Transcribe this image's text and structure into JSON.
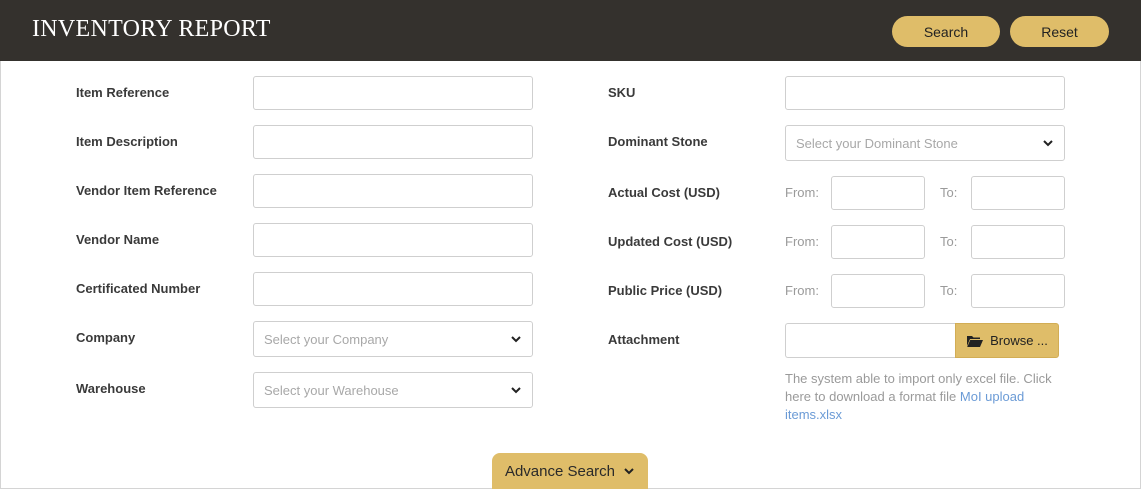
{
  "header": {
    "title": "INVENTORY REPORT",
    "search_label": "Search",
    "reset_label": "Reset"
  },
  "left": {
    "item_reference": "Item Reference",
    "item_description": "Item Description",
    "vendor_item_reference": "Vendor Item Reference",
    "vendor_name": "Vendor Name",
    "certificated_number": "Certificated Number",
    "company": "Company",
    "company_placeholder": "Select your Company",
    "warehouse": "Warehouse",
    "warehouse_placeholder": "Select your Warehouse"
  },
  "right": {
    "sku": "SKU",
    "dominant_stone": "Dominant Stone",
    "dominant_stone_placeholder": "Select your Dominant Stone",
    "actual_cost": "Actual Cost (USD)",
    "updated_cost": "Updated Cost (USD)",
    "public_price": "Public Price (USD)",
    "from_label": "From:",
    "to_label": "To:",
    "attachment": "Attachment",
    "browse_label": "Browse ...",
    "help_text": "The system able to import only excel file. Click here to download a format file ",
    "help_link": "MoI upload items.xlsx"
  },
  "footer": {
    "advance_search_label": "Advance Search"
  },
  "colors": {
    "header_bg": "#34312d",
    "accent": "#dfbd69",
    "link": "#6b9bd6"
  }
}
